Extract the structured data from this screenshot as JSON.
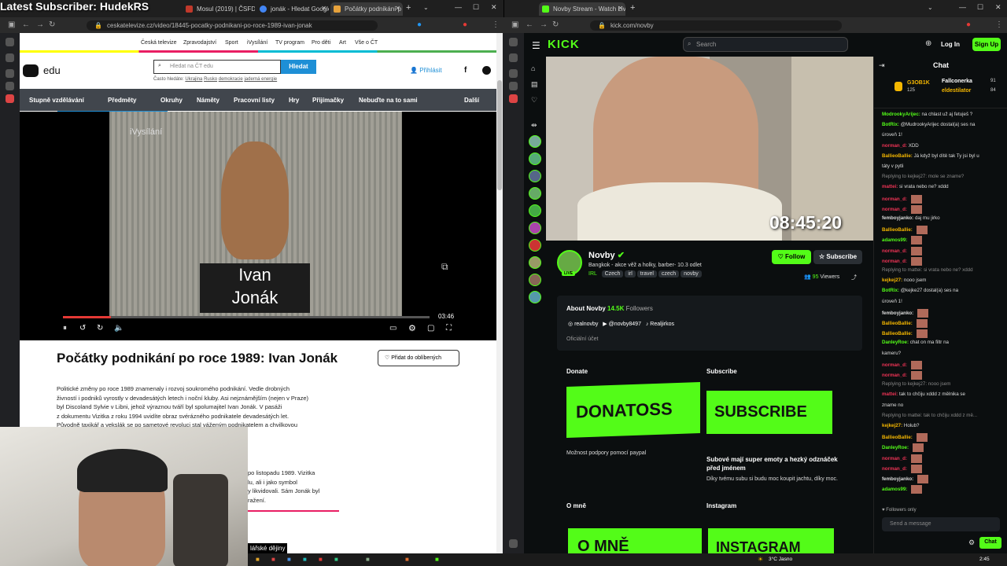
{
  "overlay": {
    "title": "Latest Subscriber: HudekRS",
    "webcam_caption": "lářské dějiny"
  },
  "left_tabs": [
    {
      "label": "Mosul (2019) | ČSFD.cz",
      "color": "#c0392b"
    },
    {
      "label": "jonák - Hledat Googlem",
      "color": "#4285f4"
    },
    {
      "label": "Počátky podnikání p",
      "color": "#e6a23c"
    }
  ],
  "left_url": "ceskatelevize.cz/video/18445-pocatky-podnikani-po-roce-1989-ivan-jonak",
  "right_tab": {
    "label": "Novby Stream - Watch Liv",
    "color": "#53fc18"
  },
  "right_url": "kick.com/novby",
  "ct": {
    "topnav": [
      "Česká televize",
      "Zpravodajství",
      "Sport",
      "iVysílání",
      "TV program",
      "Pro děti",
      "Art",
      "Vše o ČT"
    ],
    "logo": "edu",
    "search_placeholder": "Hledat na ČT edu",
    "search_button": "Hledat",
    "login": "Přihlásit",
    "often_label": "Často hledáte:",
    "often": [
      "Ukrajina",
      "Rusko",
      "demokracie",
      "jaderná energie"
    ],
    "menu": [
      "Stupně vzdělávání",
      "Předměty",
      "Okruhy",
      "Náměty",
      "Pracovní listy",
      "Hry",
      "Přijímačky",
      "Nebuďte na to sami",
      "Další"
    ],
    "video": {
      "watermark": "iVysílání",
      "caption1": "Ivan",
      "caption2": "Jonák",
      "duration": "03:46",
      "progress": 0.13
    },
    "title": "Počátky podnikání po roce 1989: Ivan Jonák",
    "fav_button": "Přidat do oblíbených",
    "desc": [
      "Politické změny po roce 1989 znamenaly i rozvoj soukromého podnikání. Vedle drobných",
      "živností i podniků vyrostly v devadesátých letech i noční kluby. Asi nejznámějším (nejen v Praze)",
      "byl Discoland Sylvie v Libni, jehož výraznou tváří byl spolumajitel Ivan Jonák. V pasáži",
      "z dokumentu Vizitka z roku 1994 uvidíte obraz svérázného podnikatele devadesátých let.",
      "Původně taxikář a vekslák se po sametové revoluci stal váženým podnikatelem a chvilkovou"
    ],
    "desc2": [
      "po listopadu 1989. Vizitka",
      "lu, ali i jako symbol",
      "y likvidovali. Sám Jonák byl",
      "ražení."
    ]
  },
  "kick": {
    "logo": "KICK",
    "search_placeholder": "Search",
    "login": "Log In",
    "signup": "Sign Up",
    "clock": "08:45:20",
    "streamer": "Novby",
    "live": "LIVE",
    "stream_title": "Bangkok -  akce věž a holky, barber- 10.3 odlet",
    "category": "IRL",
    "tags": [
      "Czech",
      "irl",
      "travel",
      "czech",
      "novby"
    ],
    "follow": "Follow",
    "subscribe": "Subscribe",
    "viewers": "95",
    "viewers_label": "Viewers",
    "about": "About Novby",
    "followers": "14.5K",
    "followers_label": "Followers",
    "socials": [
      "realnovby",
      "@novby8497",
      "Realjirkos"
    ],
    "official": "Oficiální účet",
    "panels": [
      {
        "title": "Donate",
        "banner": "DONATOSS",
        "text": "Možnost podpory pomocí paypal"
      },
      {
        "title": "Subscribe",
        "banner": "SUBSCRIBE",
        "text": "Subové mají super emoty a hezký odznáček před jménem",
        "text2": "Díky tvému subu si budu moc koupit jachtu, díky moc."
      },
      {
        "title": "O mně",
        "banner": "O MNĚ"
      },
      {
        "title": "Instagram",
        "banner": "INSTAGRAM"
      }
    ],
    "chat_title": "Chat",
    "top_gifters": [
      {
        "name": "G3OB1K",
        "count": "125"
      },
      {
        "name": "Fallconerka",
        "count": "91"
      },
      {
        "name": "eldestilator",
        "count": "84"
      }
    ],
    "chat_input": "Send a message",
    "chat_button": "Chat",
    "followers_only": "Followers only",
    "chat": [
      {
        "user": "ModrookyArijec:",
        "msg": "na chlast už aj fetuješ ?",
        "color": "#53fc18"
      },
      {
        "user": "BotRix:",
        "msg": "@MudrookyArijec dostal(a) ses na",
        "color": "#53fc18"
      },
      {
        "user": "",
        "msg": "úroveň 1!",
        "color": "#53fc18"
      },
      {
        "user": "norman_d:",
        "msg": "XDD",
        "color": "#e35"
      },
      {
        "user": "BallieoBallie:",
        "msg": "Já když byl dítě tak Ty jsi byl u",
        "color": "#f5b700"
      },
      {
        "user": "",
        "msg": "táty v pytli",
        "color": "#f5b700"
      },
      {
        "user": "",
        "msg": "Replying to kejkej27: mole se zname?",
        "color": "#888"
      },
      {
        "user": "mattei:",
        "msg": "si vrata nebo ne? xddd",
        "color": "#e35"
      },
      {
        "user": "norman_d:",
        "msg": "",
        "color": "#e35"
      },
      {
        "user": "norman_d:",
        "msg": "",
        "color": "#e35"
      },
      {
        "user": "femboyjanko:",
        "msg": "daj mu jirko",
        "color": "#ddd"
      },
      {
        "user": "BallieoBallie:",
        "msg": "",
        "color": "#f5b700"
      },
      {
        "user": "adamos99:",
        "msg": "",
        "color": "#53fc18"
      },
      {
        "user": "norman_d:",
        "msg": "",
        "color": "#e35"
      },
      {
        "user": "norman_d:",
        "msg": "",
        "color": "#e35"
      },
      {
        "user": "",
        "msg": "Replying to mattei: si vrata nebo ne? xddd",
        "color": "#888"
      },
      {
        "user": "kejkej27:",
        "msg": "nooo jsem",
        "color": "#f5b700"
      },
      {
        "user": "BotRix:",
        "msg": "@kejke27 dostal(a) ses na",
        "color": "#53fc18"
      },
      {
        "user": "",
        "msg": "úroveň 1!",
        "color": "#53fc18"
      },
      {
        "user": "femboyjanko:",
        "msg": "",
        "color": "#ddd"
      },
      {
        "user": "BallieoBallie:",
        "msg": "",
        "color": "#f5b700"
      },
      {
        "user": "BallieoBallie:",
        "msg": "",
        "color": "#f5b700"
      },
      {
        "user": "DanleyRoe:",
        "msg": "chat on ma filtr na",
        "color": "#53fc18"
      },
      {
        "user": "",
        "msg": "kameru?",
        "color": "#53fc18"
      },
      {
        "user": "norman_d:",
        "msg": "",
        "color": "#e35"
      },
      {
        "user": "norman_d:",
        "msg": "",
        "color": "#e35"
      },
      {
        "user": "",
        "msg": "Replying to kejkej27: nooo jsem",
        "color": "#888"
      },
      {
        "user": "mattei:",
        "msg": "tak to chčiju xddd z mělnika se",
        "color": "#e35"
      },
      {
        "user": "",
        "msg": "zname no",
        "color": "#e35"
      },
      {
        "user": "",
        "msg": "Replying to mattei: tak to chčiju xddd z mě...",
        "color": "#888"
      },
      {
        "user": "kejkej27:",
        "msg": "Holub?",
        "color": "#f5b700"
      },
      {
        "user": "BallieoBallie:",
        "msg": "",
        "color": "#f5b700"
      },
      {
        "user": "DanleyRoe:",
        "msg": "",
        "color": "#53fc18"
      },
      {
        "user": "norman_d:",
        "msg": "",
        "color": "#e35"
      },
      {
        "user": "norman_d:",
        "msg": "",
        "color": "#e35"
      },
      {
        "user": "femboyjanko:",
        "msg": "",
        "color": "#ddd"
      },
      {
        "user": "adamos99:",
        "msg": "",
        "color": "#53fc18"
      }
    ]
  },
  "taskbar": {
    "weather": "3°C",
    "weather_label": "Jasno",
    "time": "2:45"
  }
}
